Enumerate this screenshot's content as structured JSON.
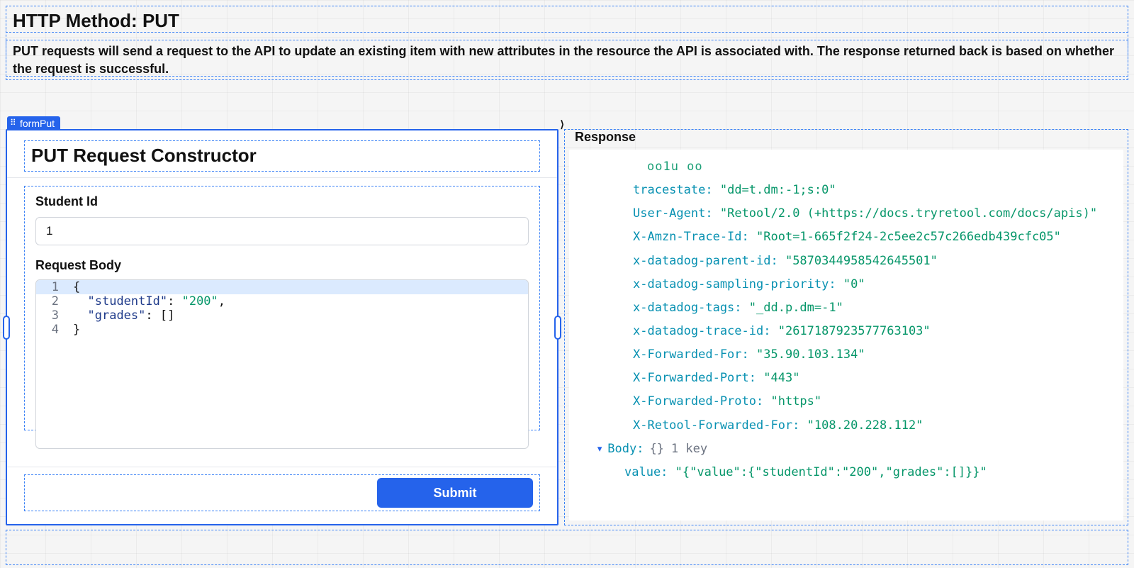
{
  "header": {
    "title": "HTTP Method: PUT",
    "description": "PUT requests will send a request to the API to update an existing item with new attributes in the resource the API is associated with. The response returned back is based on whether the request is successful."
  },
  "form": {
    "component_name": "formPut",
    "title": "PUT Request Constructor",
    "fields": {
      "student_id": {
        "label": "Student Id",
        "value": "1"
      },
      "request_body": {
        "label": "Request Body",
        "lines": [
          "{",
          "  \"studentId\": \"200\",",
          "  \"grades\": []",
          "}"
        ]
      }
    },
    "submit_label": "Submit"
  },
  "response": {
    "title": "Response",
    "truncated_top": "oo1u oo",
    "headers": [
      {
        "key": "tracestate",
        "value": "\"dd=t.dm:-1;s:0\""
      },
      {
        "key": "User-Agent",
        "value": "\"Retool/2.0 (+https://docs.tryretool.com/docs/apis)\""
      },
      {
        "key": "X-Amzn-Trace-Id",
        "value": "\"Root=1-665f2f24-2c5ee2c57c266edb439cfc05\""
      },
      {
        "key": "x-datadog-parent-id",
        "value": "\"5870344958542645501\""
      },
      {
        "key": "x-datadog-sampling-priority",
        "value": "\"0\""
      },
      {
        "key": "x-datadog-tags",
        "value": "\"_dd.p.dm=-1\""
      },
      {
        "key": "x-datadog-trace-id",
        "value": "\"2617187923577763103\""
      },
      {
        "key": "X-Forwarded-For",
        "value": "\"35.90.103.134\""
      },
      {
        "key": "X-Forwarded-Port",
        "value": "\"443\""
      },
      {
        "key": "X-Forwarded-Proto",
        "value": "\"https\""
      },
      {
        "key": "X-Retool-Forwarded-For",
        "value": "\"108.20.228.112\""
      }
    ],
    "body_label": "Body:",
    "body_braces": "{}",
    "body_meta": "1 key",
    "body_value_key": "value:",
    "body_value": "\"{\"value\":{\"studentId\":\"200\",\"grades\":[]}}\""
  }
}
